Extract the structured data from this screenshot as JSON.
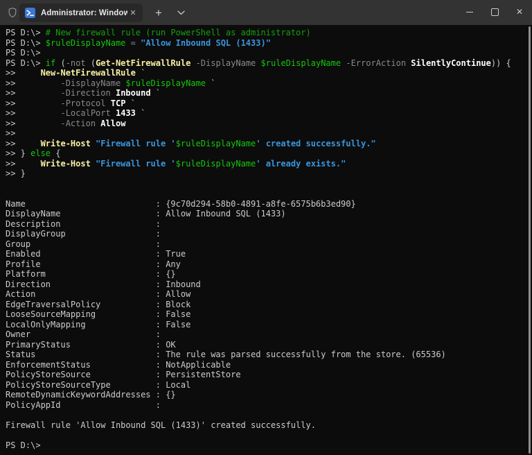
{
  "window": {
    "tab": {
      "title": "Administrator: Windows Pow",
      "close_glyph": "✕"
    },
    "new_tab_glyph": "+",
    "controls": {
      "minimize": "minimize",
      "maximize": "maximize",
      "close_glyph": "✕"
    },
    "icons": {
      "shield": "admin-elevated-shield",
      "powershell": "powershell-logo",
      "chevron": "tab-dropdown-chevron"
    }
  },
  "colors": {
    "titlebar_bg": "#333333",
    "tab_bg": "#282828",
    "terminal_bg": "#0c0c0c",
    "text_default": "#cccccc",
    "text_bright": "#ffffff",
    "comment_green": "#13a10e",
    "variable_green": "#16c60c",
    "command_yellow": "#f9f1a5",
    "parameter_gray": "#8a8a8a",
    "string_blue": "#3a96dd",
    "powershell_icon_blue": "#3b78d7"
  },
  "terminal": {
    "lines": [
      [
        [
          "p",
          "PS D:\\> "
        ],
        [
          "c",
          "# New firewall rule (run PowerShell as administrator)"
        ]
      ],
      [
        [
          "p",
          "PS D:\\> "
        ],
        [
          "v",
          "$ruleDisplayName"
        ],
        [
          "p",
          " "
        ],
        [
          "prm",
          "="
        ],
        [
          "p",
          " "
        ],
        [
          "s",
          "\"Allow Inbound SQL (1433)\""
        ]
      ],
      [
        [
          "p",
          "PS D:\\>"
        ]
      ],
      [
        [
          "p",
          "PS D:\\> "
        ],
        [
          "v",
          "if"
        ],
        [
          "p",
          " ("
        ],
        [
          "prm",
          "-not"
        ],
        [
          "p",
          " ("
        ],
        [
          "cmd",
          "Get-NetFirewallRule"
        ],
        [
          "p",
          " "
        ],
        [
          "prm",
          "-DisplayName"
        ],
        [
          "p",
          " "
        ],
        [
          "v",
          "$ruleDisplayName"
        ],
        [
          "p",
          " "
        ],
        [
          "prm",
          "-ErrorAction"
        ],
        [
          "p",
          " "
        ],
        [
          "w",
          "SilentlyContinue"
        ],
        [
          "p",
          ")) {"
        ]
      ],
      [
        [
          "p",
          ">>     "
        ],
        [
          "cmd",
          "New-NetFirewallRule"
        ],
        [
          "p",
          " `"
        ]
      ],
      [
        [
          "p",
          ">>         "
        ],
        [
          "prm",
          "-DisplayName"
        ],
        [
          "p",
          " "
        ],
        [
          "v",
          "$ruleDisplayName"
        ],
        [
          "p",
          " `"
        ]
      ],
      [
        [
          "p",
          ">>         "
        ],
        [
          "prm",
          "-Direction"
        ],
        [
          "p",
          " "
        ],
        [
          "w",
          "Inbound"
        ],
        [
          "p",
          " `"
        ]
      ],
      [
        [
          "p",
          ">>         "
        ],
        [
          "prm",
          "-Protocol"
        ],
        [
          "p",
          " "
        ],
        [
          "w",
          "TCP"
        ],
        [
          "p",
          " `"
        ]
      ],
      [
        [
          "p",
          ">>         "
        ],
        [
          "prm",
          "-LocalPort"
        ],
        [
          "p",
          " "
        ],
        [
          "w",
          "1433"
        ],
        [
          "p",
          " `"
        ]
      ],
      [
        [
          "p",
          ">>         "
        ],
        [
          "prm",
          "-Action"
        ],
        [
          "p",
          " "
        ],
        [
          "w",
          "Allow"
        ]
      ],
      [
        [
          "p",
          ">>"
        ]
      ],
      [
        [
          "p",
          ">>     "
        ],
        [
          "cmd",
          "Write-Host"
        ],
        [
          "p",
          " "
        ],
        [
          "s",
          "\"Firewall rule '"
        ],
        [
          "v",
          "$ruleDisplayName"
        ],
        [
          "s",
          "' created successfully.\""
        ]
      ],
      [
        [
          "p",
          ">> } "
        ],
        [
          "v",
          "else"
        ],
        [
          "p",
          " {"
        ]
      ],
      [
        [
          "p",
          ">>     "
        ],
        [
          "cmd",
          "Write-Host"
        ],
        [
          "p",
          " "
        ],
        [
          "s",
          "\"Firewall rule '"
        ],
        [
          "v",
          "$ruleDisplayName"
        ],
        [
          "s",
          "' already exists.\""
        ]
      ],
      [
        [
          "p",
          ">> }"
        ]
      ],
      [],
      [],
      [
        [
          "p",
          "Name                          : {9c70d294-58b0-4891-a8fe-6575b6b3ed90}"
        ]
      ],
      [
        [
          "p",
          "DisplayName                   : Allow Inbound SQL (1433)"
        ]
      ],
      [
        [
          "p",
          "Description                   :"
        ]
      ],
      [
        [
          "p",
          "DisplayGroup                  :"
        ]
      ],
      [
        [
          "p",
          "Group                         :"
        ]
      ],
      [
        [
          "p",
          "Enabled                       : True"
        ]
      ],
      [
        [
          "p",
          "Profile                       : Any"
        ]
      ],
      [
        [
          "p",
          "Platform                      : {}"
        ]
      ],
      [
        [
          "p",
          "Direction                     : Inbound"
        ]
      ],
      [
        [
          "p",
          "Action                        : Allow"
        ]
      ],
      [
        [
          "p",
          "EdgeTraversalPolicy           : Block"
        ]
      ],
      [
        [
          "p",
          "LooseSourceMapping            : False"
        ]
      ],
      [
        [
          "p",
          "LocalOnlyMapping              : False"
        ]
      ],
      [
        [
          "p",
          "Owner                         :"
        ]
      ],
      [
        [
          "p",
          "PrimaryStatus                 : OK"
        ]
      ],
      [
        [
          "p",
          "Status                        : The rule was parsed successfully from the store. (65536)"
        ]
      ],
      [
        [
          "p",
          "EnforcementStatus             : NotApplicable"
        ]
      ],
      [
        [
          "p",
          "PolicyStoreSource             : PersistentStore"
        ]
      ],
      [
        [
          "p",
          "PolicyStoreSourceType         : Local"
        ]
      ],
      [
        [
          "p",
          "RemoteDynamicKeywordAddresses : {}"
        ]
      ],
      [
        [
          "p",
          "PolicyAppId                   :"
        ]
      ],
      [],
      [
        [
          "p",
          "Firewall rule 'Allow Inbound SQL (1433)' created successfully."
        ]
      ],
      [],
      [
        [
          "p",
          "PS D:\\>"
        ]
      ]
    ]
  }
}
